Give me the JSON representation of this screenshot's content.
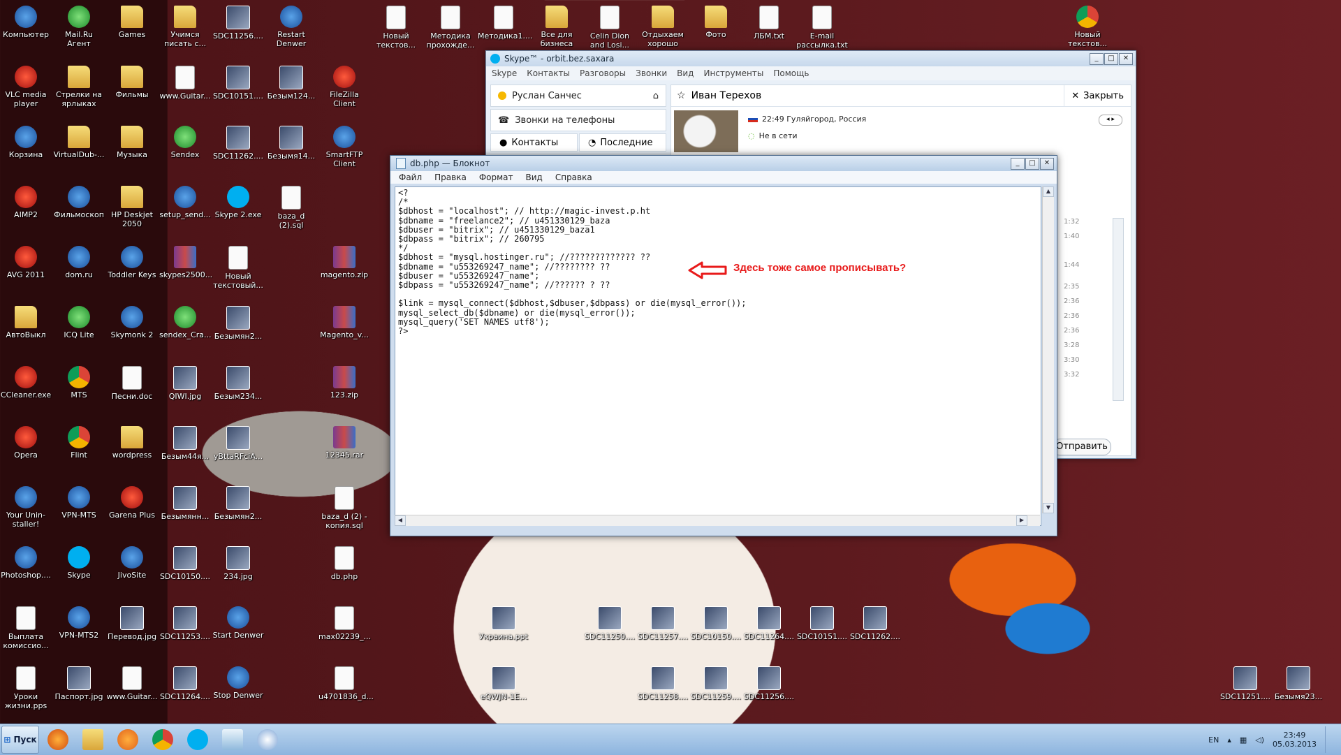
{
  "desktop_icons": [
    {
      "label": "Компьютер",
      "kind": "app"
    },
    {
      "label": "Mail.Ru Агент",
      "kind": "green"
    },
    {
      "label": "Games",
      "kind": "folder"
    },
    {
      "label": "Учимся писать с...",
      "kind": "folder"
    },
    {
      "label": "SDC11256....",
      "kind": "img"
    },
    {
      "label": "Restart Denwer",
      "kind": "app"
    },
    {
      "label": "Новый текстов...",
      "kind": "file"
    },
    {
      "label": "Методика прохожде...",
      "kind": "file"
    },
    {
      "label": "Методика1....",
      "kind": "file"
    },
    {
      "label": "Все для бизнеса",
      "kind": "folder"
    },
    {
      "label": "Celin Dion and Losi...",
      "kind": "file"
    },
    {
      "label": "Отдыхаем хорошо",
      "kind": "folder"
    },
    {
      "label": "Фото",
      "kind": "folder"
    },
    {
      "label": "ЛБМ.txt",
      "kind": "file"
    },
    {
      "label": "E-mail рассылка.txt",
      "kind": "file"
    },
    {
      "label": "Новый текстов...",
      "kind": "chrome"
    },
    {
      "label": "VLC media player",
      "kind": "red"
    },
    {
      "label": "Стрелки на ярлыках",
      "kind": "folder"
    },
    {
      "label": "Фильмы",
      "kind": "folder"
    },
    {
      "label": "www.Guitar...",
      "kind": "file"
    },
    {
      "label": "SDC10151....",
      "kind": "img"
    },
    {
      "label": "Безым124...",
      "kind": "img"
    },
    {
      "label": "FileZilla Client",
      "kind": "red"
    },
    {
      "label": "Корзина",
      "kind": "app"
    },
    {
      "label": "VirtualDub-...",
      "kind": "folder"
    },
    {
      "label": "Музыка",
      "kind": "folder"
    },
    {
      "label": "Sendex",
      "kind": "green"
    },
    {
      "label": "SDC11262....",
      "kind": "img"
    },
    {
      "label": "Безымя14...",
      "kind": "img"
    },
    {
      "label": "SmartFTP Client",
      "kind": "app"
    },
    {
      "label": "AIMP2",
      "kind": "red"
    },
    {
      "label": "Фильмоскоп",
      "kind": "app"
    },
    {
      "label": "HP Deskjet 2050",
      "kind": "folder"
    },
    {
      "label": "setup_send...",
      "kind": "app"
    },
    {
      "label": "Skype 2.exe",
      "kind": "skype"
    },
    {
      "label": "baza_d (2).sql",
      "kind": "file"
    },
    {
      "label": "AVG 2011",
      "kind": "red"
    },
    {
      "label": "dom.ru",
      "kind": "app"
    },
    {
      "label": "Toddler Keys",
      "kind": "app"
    },
    {
      "label": "skypes2500...",
      "kind": "rar"
    },
    {
      "label": "Новый текстовый...",
      "kind": "file"
    },
    {
      "label": "magento.zip",
      "kind": "rar"
    },
    {
      "label": "АвтоВыкл",
      "kind": "folder"
    },
    {
      "label": "ICQ Lite",
      "kind": "green"
    },
    {
      "label": "Skymonk 2",
      "kind": "app"
    },
    {
      "label": "sendex_Cra...",
      "kind": "green"
    },
    {
      "label": "Безымян2...",
      "kind": "img"
    },
    {
      "label": "Magento_v...",
      "kind": "rar"
    },
    {
      "label": "CCleaner.exe",
      "kind": "red"
    },
    {
      "label": "MTS",
      "kind": "chrome"
    },
    {
      "label": "Песни.doc",
      "kind": "file"
    },
    {
      "label": "QIWI.jpg",
      "kind": "img"
    },
    {
      "label": "Безым234...",
      "kind": "img"
    },
    {
      "label": "123.zip",
      "kind": "rar"
    },
    {
      "label": "Opera",
      "kind": "red"
    },
    {
      "label": "Flint",
      "kind": "chrome"
    },
    {
      "label": "wordpress",
      "kind": "folder"
    },
    {
      "label": "Безым44я...",
      "kind": "img"
    },
    {
      "label": "yBttaRFciA...",
      "kind": "img"
    },
    {
      "label": "12345.rar",
      "kind": "rar"
    },
    {
      "label": "Your Unin-staller!",
      "kind": "app"
    },
    {
      "label": "VPN-MTS",
      "kind": "app"
    },
    {
      "label": "Garena Plus",
      "kind": "red"
    },
    {
      "label": "Безымянн...",
      "kind": "img"
    },
    {
      "label": "Безымян2...",
      "kind": "img"
    },
    {
      "label": "baza_d (2) - копия.sql",
      "kind": "file"
    },
    {
      "label": "Photoshop....",
      "kind": "app"
    },
    {
      "label": "Skype",
      "kind": "skype"
    },
    {
      "label": "JivoSite",
      "kind": "app"
    },
    {
      "label": "SDC10150....",
      "kind": "img"
    },
    {
      "label": "234.jpg",
      "kind": "img"
    },
    {
      "label": "db.php",
      "kind": "file"
    },
    {
      "label": "Выплата комиссио...",
      "kind": "file"
    },
    {
      "label": "VPN-MTS2",
      "kind": "app"
    },
    {
      "label": "Перевод.jpg",
      "kind": "img"
    },
    {
      "label": "SDC11253....",
      "kind": "img"
    },
    {
      "label": "Start Denwer",
      "kind": "app"
    },
    {
      "label": "max02239_...",
      "kind": "file"
    },
    {
      "label": "Уроки жизни.pps",
      "kind": "file"
    },
    {
      "label": "Паспорт.jpg",
      "kind": "img"
    },
    {
      "label": "www.Guitar...",
      "kind": "file"
    },
    {
      "label": "SDC11264....",
      "kind": "img"
    },
    {
      "label": "Stop Denwer",
      "kind": "app"
    },
    {
      "label": "u4701836_d...",
      "kind": "file"
    },
    {
      "label": "Украина.ppt",
      "kind": "img"
    },
    {
      "label": "SDC11250....",
      "kind": "img"
    },
    {
      "label": "SDC11257....",
      "kind": "img"
    },
    {
      "label": "SDC10150....",
      "kind": "img"
    },
    {
      "label": "SDC11264....",
      "kind": "img"
    },
    {
      "label": "SDC10151....",
      "kind": "img"
    },
    {
      "label": "SDC11262....",
      "kind": "img"
    },
    {
      "label": "eQWJN-1E...",
      "kind": "img"
    },
    {
      "label": "SDC11258....",
      "kind": "img"
    },
    {
      "label": "SDC11259....",
      "kind": "img"
    },
    {
      "label": "SDC11256....",
      "kind": "img"
    },
    {
      "label": "SDC11251....",
      "kind": "img"
    },
    {
      "label": "Безымя23...",
      "kind": "img"
    }
  ],
  "skype": {
    "title": "Skype™ - orbit.bez.saxara",
    "menu": [
      "Skype",
      "Контакты",
      "Разговоры",
      "Звонки",
      "Вид",
      "Инструменты",
      "Помощь"
    ],
    "user_name": "Руслан Санчес",
    "calls_label": "Звонки на телефоны",
    "tabs": [
      "Контакты",
      "Последние"
    ],
    "contact_name": "Иван Терехов",
    "close_label": "Закрыть",
    "location": "22:49 Гуляйгород, Россия",
    "status": "Не в сети",
    "times": [
      "1:32",
      "1:40",
      "1:44",
      "2:35",
      "2:36",
      "2:36",
      "2:36",
      "3:28",
      "3:30",
      "3:32"
    ],
    "send_label": "Отправить"
  },
  "notepad": {
    "title": "db.php — Блокнот",
    "menu": [
      "Файл",
      "Правка",
      "Формат",
      "Вид",
      "Справка"
    ],
    "content": "<?\n/*\n$dbhost = \"localhost\"; // http://magic-invest.p.ht\n$dbname = \"freelance2\"; // u451330129_baza\n$dbuser = \"bitrix\"; // u451330129_baza1\n$dbpass = \"bitrix\"; // 260795\n*/\n$dbhost = \"mysql.hostinger.ru\"; //????????????? ??\n$dbname = \"u553269247_name\"; //???????? ??\n$dbuser = \"u553269247_name\";\n$dbpass = \"u553269247_name\"; //?????? ? ??\n\n$link = mysql_connect($dbhost,$dbuser,$dbpass) or die(mysql_error());\nmysql_select_db($dbname) or die(mysql_error());\nmysql_query('SET NAMES utf8');\n?>"
  },
  "annotation": {
    "text": "Здесь тоже самое прописывать?",
    "color": "#e81a1a"
  },
  "taskbar": {
    "start_label": "Пуск",
    "apps": [
      "firefox-icon",
      "explorer-icon",
      "media-player-icon",
      "chrome-icon",
      "skype-icon",
      "notepad-icon",
      "paint-icon"
    ],
    "lang": "EN",
    "time": "23:49",
    "date": "05.03.2013"
  }
}
